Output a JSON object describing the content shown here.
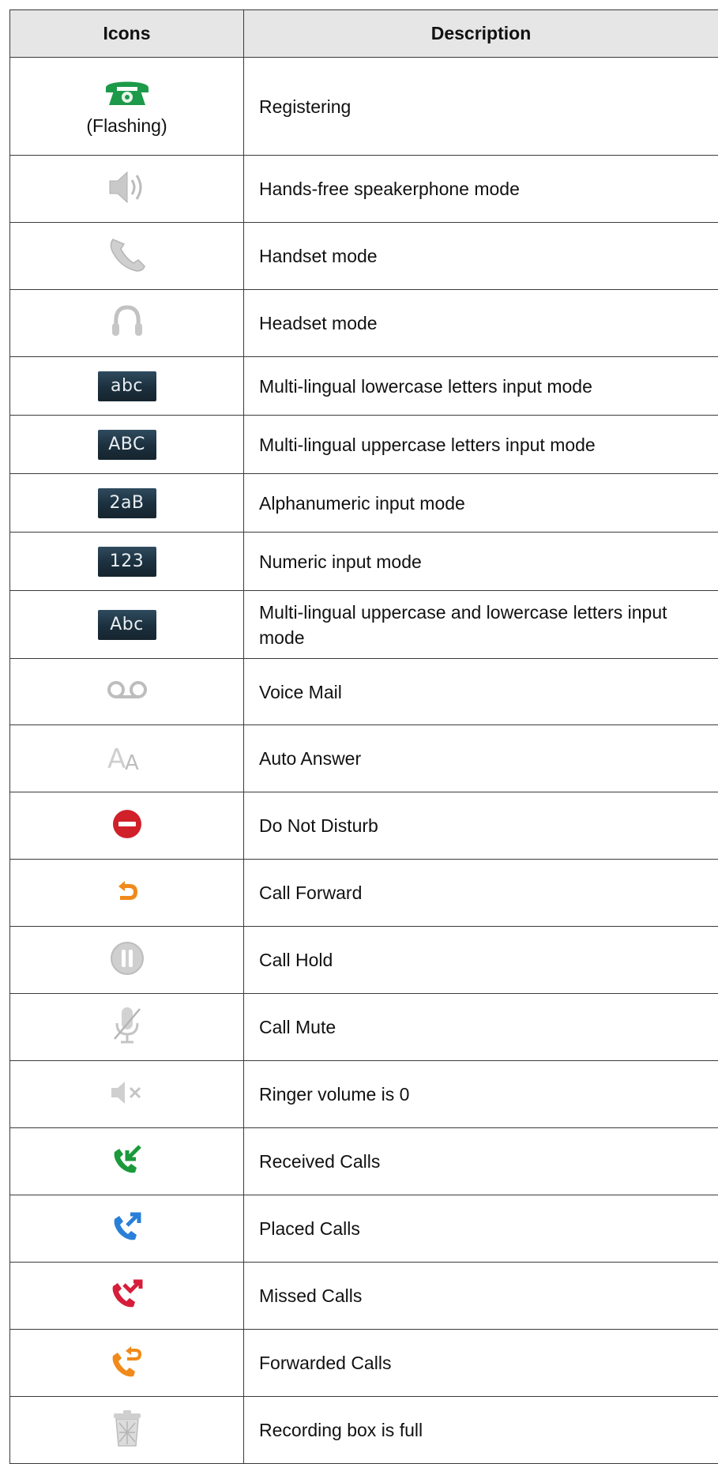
{
  "table": {
    "headers": {
      "icons": "Icons",
      "description": "Description"
    },
    "rows": [
      {
        "icon": "phone-registering-icon",
        "icon_note": "(Flashing)",
        "description": "Registering",
        "height": 124
      },
      {
        "icon": "speaker-icon",
        "description": "Hands-free speakerphone mode",
        "height": 85
      },
      {
        "icon": "handset-icon",
        "description": "Handset mode",
        "height": 85
      },
      {
        "icon": "headset-icon",
        "description": "Headset mode",
        "height": 85
      },
      {
        "icon": "input-mode-badge-icon",
        "badge_text": "abc",
        "description": "Multi-lingual lowercase letters input mode",
        "height": 74
      },
      {
        "icon": "input-mode-badge-icon",
        "badge_text": "ABC",
        "description": "Multi-lingual uppercase letters input mode",
        "height": 74
      },
      {
        "icon": "input-mode-badge-icon",
        "badge_text": "2aB",
        "description": "Alphanumeric input mode",
        "height": 74
      },
      {
        "icon": "input-mode-badge-icon",
        "badge_text": "123",
        "description": "Numeric input mode",
        "height": 74
      },
      {
        "icon": "input-mode-badge-icon",
        "badge_text": "Abc",
        "description": "Multi-lingual uppercase and lowercase letters input mode",
        "height": 86
      },
      {
        "icon": "voicemail-icon",
        "description": "Voice Mail",
        "height": 84
      },
      {
        "icon": "auto-answer-icon",
        "description": "Auto Answer",
        "height": 85
      },
      {
        "icon": "do-not-disturb-icon",
        "description": "Do Not Disturb",
        "height": 85
      },
      {
        "icon": "call-forward-icon",
        "description": "Call Forward",
        "height": 85
      },
      {
        "icon": "call-hold-icon",
        "description": "Call Hold",
        "height": 85
      },
      {
        "icon": "call-mute-icon",
        "description": "Call Mute",
        "height": 85
      },
      {
        "icon": "ringer-off-icon",
        "description": "Ringer volume is 0",
        "height": 85
      },
      {
        "icon": "received-calls-icon",
        "description": "Received Calls",
        "height": 85
      },
      {
        "icon": "placed-calls-icon",
        "description": "Placed Calls",
        "height": 85
      },
      {
        "icon": "missed-calls-icon",
        "description": "Missed Calls",
        "height": 85
      },
      {
        "icon": "forwarded-calls-icon",
        "description": "Forwarded Calls",
        "height": 85
      },
      {
        "icon": "recording-box-full-icon",
        "description": "Recording box is full",
        "height": 85
      }
    ]
  },
  "colors": {
    "header_bg": "#e6e6e6",
    "border": "#3a3a3a",
    "registering_green": "#1c9a4a",
    "dnd_red": "#d0202a",
    "forward_orange": "#f08a1a",
    "received_green": "#1a9a3a",
    "placed_blue": "#2a7fd8",
    "missed_red": "#d61e3a",
    "icon_gray": "#b8b8b8"
  }
}
